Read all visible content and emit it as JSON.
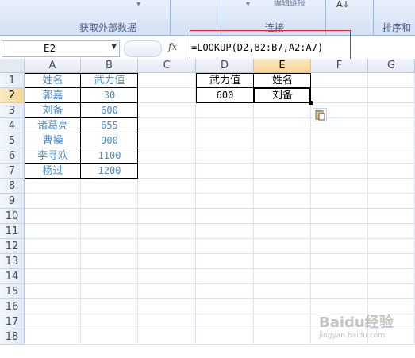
{
  "ribbon": {
    "top_button_left": "",
    "top_button_mid": "编辑链接",
    "sort_icon": "sort-az-icon",
    "groups": [
      {
        "label": "获取外部数据"
      },
      {
        "label": "连接"
      },
      {
        "label": "排序和"
      }
    ]
  },
  "formula_bar": {
    "name_box": "E2",
    "fx_label": "fx",
    "formula": "=LOOKUP(D2,B2:B7,A2:A7)"
  },
  "columns": [
    "A",
    "B",
    "C",
    "D",
    "E",
    "F",
    "G"
  ],
  "rows": [
    "1",
    "2",
    "3",
    "4",
    "5",
    "6",
    "7",
    "8",
    "9",
    "10",
    "11",
    "12",
    "13",
    "14",
    "15",
    "16",
    "17",
    "18"
  ],
  "table": {
    "header": {
      "name": "姓名",
      "value": "武力值"
    },
    "records": [
      {
        "name": "郭嘉",
        "value": "30"
      },
      {
        "name": "刘备",
        "value": "600"
      },
      {
        "name": "诸葛亮",
        "value": "655"
      },
      {
        "name": "曹操",
        "value": "900"
      },
      {
        "name": "李寻欢",
        "value": "1100"
      },
      {
        "name": "杨过",
        "value": "1200"
      }
    ]
  },
  "lookup": {
    "header_value": "武力值",
    "header_name": "姓名",
    "input_value": "600",
    "result_name": "刘备"
  },
  "selected_cell": "E2",
  "colors": {
    "accent_red": "#e0242a",
    "data_blue": "#4a8cc4"
  },
  "watermark": {
    "text": "Baidu经验",
    "sub": "jingyan.baidu.com"
  }
}
